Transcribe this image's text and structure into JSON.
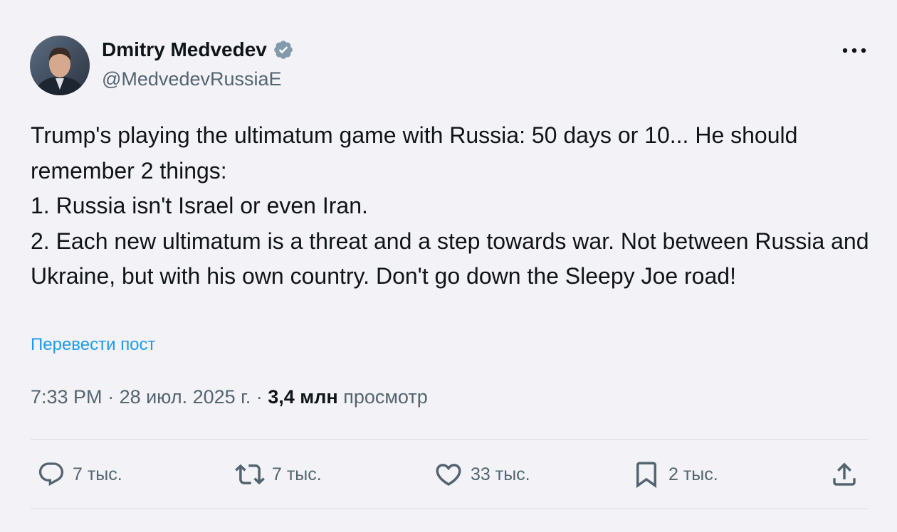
{
  "author": {
    "display_name": "Dmitry Medvedev",
    "handle": "@MedvedevRussiaE",
    "verified_icon": "verified-badge-icon",
    "verified_color": "#829aab"
  },
  "post": {
    "text": "Trump's playing the ultimatum game with Russia: 50 days or 10... He should remember 2 things:\n1. Russia isn't Israel or even Iran.\n2. Each new ultimatum is a threat and a step towards war. Not between Russia and Ukraine, but with his own country. Don't go down the Sleepy Joe road!",
    "translate_label": "Перевести пост"
  },
  "meta": {
    "time": "7:33 PM",
    "separator": " · ",
    "date": "28 июл. 2025 г.",
    "views_count": "3,4 млн",
    "views_label": "просмотр"
  },
  "actions": {
    "reply": {
      "icon": "reply-icon",
      "count": "7 тыс."
    },
    "repost": {
      "icon": "repost-icon",
      "count": "7 тыс."
    },
    "like": {
      "icon": "heart-icon",
      "count": "33 тыс."
    },
    "bookmark": {
      "icon": "bookmark-icon",
      "count": "2 тыс."
    },
    "share": {
      "icon": "share-icon"
    }
  },
  "colors": {
    "background": "#f3f2f6",
    "text": "#0f1419",
    "secondary_text": "#536471",
    "link": "#1d9bf0"
  }
}
